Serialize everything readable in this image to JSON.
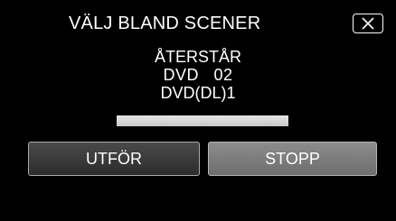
{
  "header": {
    "title": "VÄLJ BLAND SCENER",
    "close_icon": "close-x-icon"
  },
  "status": {
    "line1": "ÅTERSTÅR",
    "line2": "DVD   02",
    "line3": "DVD(DL)1"
  },
  "progress": {
    "fraction": 1.0
  },
  "buttons": {
    "execute_label": "UTFÖR",
    "stop_label": "STOPP"
  },
  "colors": {
    "background": "#000000",
    "text": "#ffffff",
    "execute_button": "#3a3a3a",
    "stop_button": "#7c7c7c",
    "progress_fill": "#d9d9d9"
  }
}
